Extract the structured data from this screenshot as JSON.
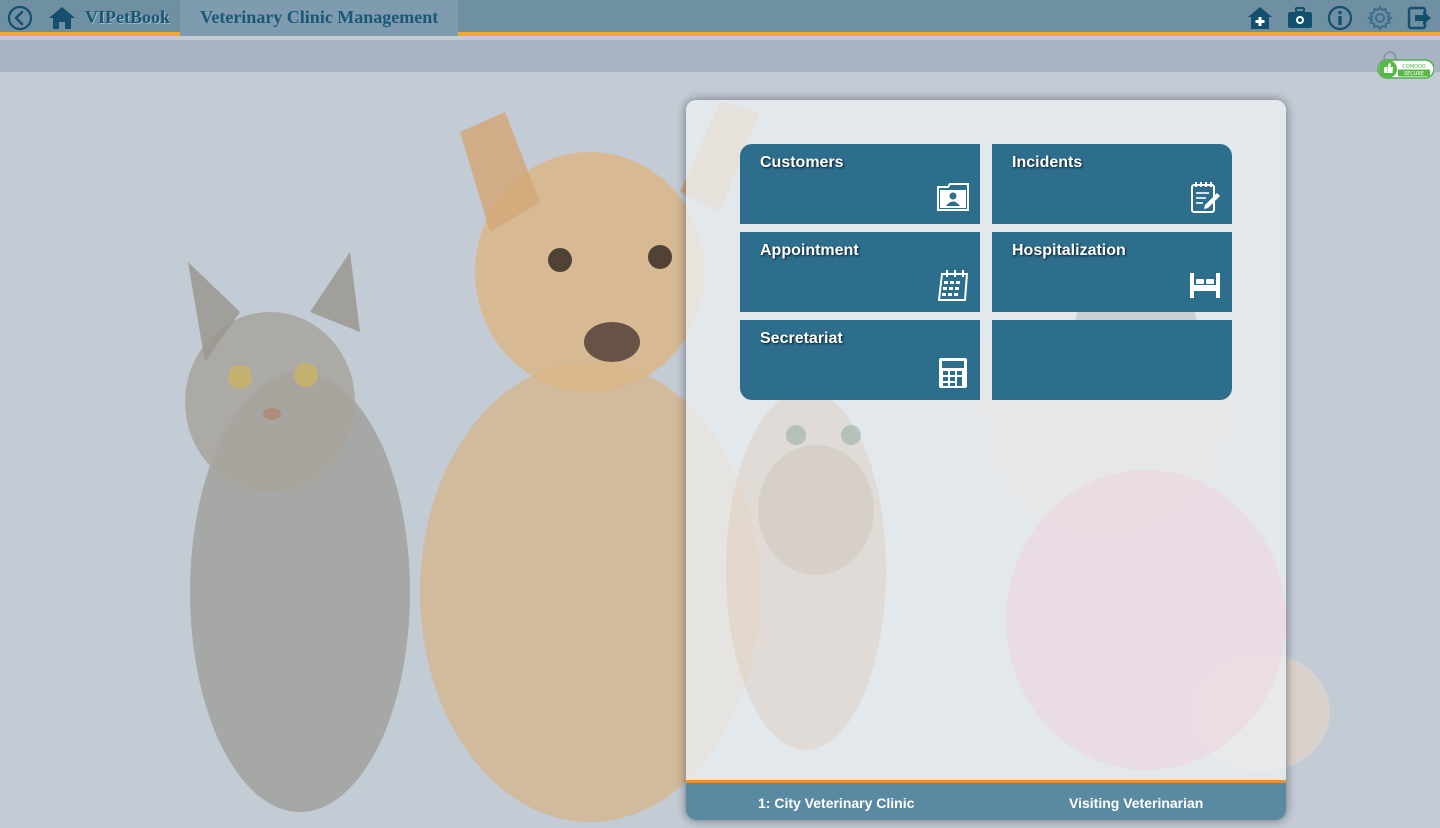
{
  "header": {
    "app_name": "VIPetBook",
    "page_title": "Veterinary Clinic Management",
    "icons": [
      "back-icon",
      "home-icon",
      "add-home-icon",
      "toolbox-icon",
      "info-icon",
      "gear-icon",
      "logout-icon"
    ]
  },
  "badge": {
    "line1": "COMODO",
    "line2": "SECURE"
  },
  "tiles": [
    {
      "label": "Customers",
      "icon": "contact-folder-icon"
    },
    {
      "label": "Incidents",
      "icon": "notepad-edit-icon"
    },
    {
      "label": "Appointment",
      "icon": "calendar-icon"
    },
    {
      "label": "Hospitalization",
      "icon": "bed-icon"
    },
    {
      "label": "Secretariat",
      "icon": "calculator-icon"
    },
    {
      "label": "",
      "icon": ""
    }
  ],
  "footer": {
    "clinic": "1: City Veterinary Clinic",
    "role": "Visiting Veterinarian"
  },
  "colors": {
    "topbar": "#6f8fa2",
    "accent": "#f1a92e",
    "tile": "#2d6e8c",
    "footer": "#5a8aa2"
  }
}
